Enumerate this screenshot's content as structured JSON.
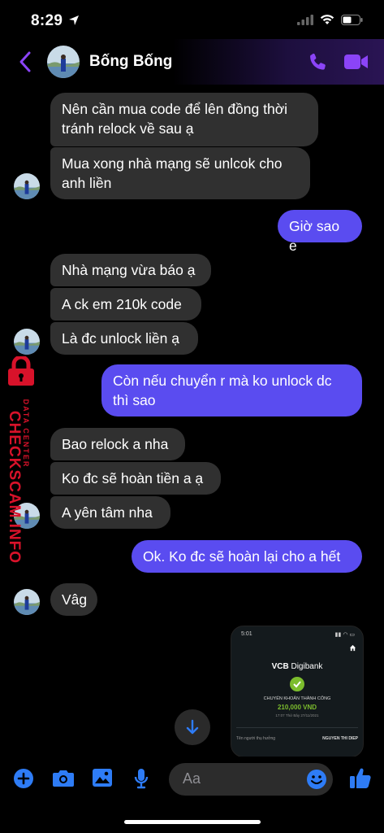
{
  "status": {
    "time": "8:29"
  },
  "header": {
    "contact_name": "Bống Bống"
  },
  "messages": [
    {
      "text": "Nên cần mua code để lên đồng thời tránh relock về sau ạ"
    },
    {
      "text": "Mua xong nhà mạng sẽ unlcok cho anh liền"
    },
    {
      "text": "Giờ sao e"
    },
    {
      "text": "Nhà mạng vừa báo ạ"
    },
    {
      "text": "A ck em 210k code"
    },
    {
      "text": "Là đc unlock liền ạ"
    },
    {
      "text": "Còn nếu chuyển r mà ko unlock dc thì sao"
    },
    {
      "text": "Bao relock a nha"
    },
    {
      "text": "Ko đc sẽ hoàn tiền a ạ"
    },
    {
      "text": "A yên tâm nha"
    },
    {
      "text": "Ok. Ko đc sẽ hoàn lại cho a hết"
    },
    {
      "text": "Vâg"
    }
  ],
  "watermark": {
    "main": "CHECKSCAM.INFO",
    "sub": "DATA CENTER"
  },
  "attachment": {
    "time": "5:01",
    "brand_bold": "VCB",
    "brand_rest": " Digibank",
    "status": "CHUYỂN KHOẢN THÀNH CÔNG",
    "amount": "210,000 VND",
    "datetime": "17:07 Thứ Bảy 27/11/2021",
    "recipient_label": "Tên người thụ hưởng",
    "recipient_value": "NGUYEN THI DIEP"
  },
  "composer": {
    "placeholder": "Aa"
  },
  "colors": {
    "outgoing": "#5a4cf0",
    "incoming": "#303030",
    "accent": "#7b3ff2",
    "composer_icon": "#2e7cf6"
  }
}
